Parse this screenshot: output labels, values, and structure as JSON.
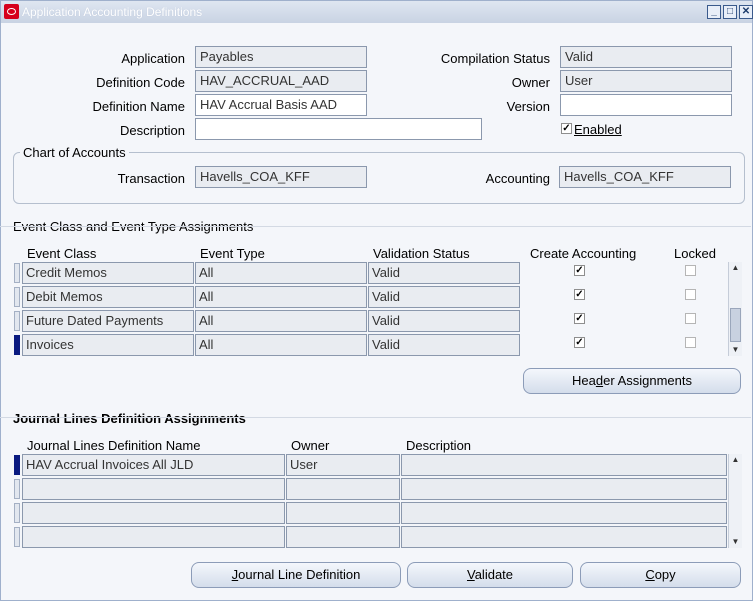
{
  "window": {
    "title": "Application Accounting Definitions"
  },
  "header_form": {
    "application_label": "Application",
    "application_value": "Payables",
    "definition_code_label": "Definition Code",
    "definition_code_value": "HAV_ACCRUAL_AAD",
    "definition_name_label": "Definition Name",
    "definition_name_value": "HAV Accrual Basis AAD",
    "description_label": "Description",
    "description_value": "",
    "compilation_status_label": "Compilation Status",
    "compilation_status_value": "Valid",
    "owner_label": "Owner",
    "owner_value": "User",
    "version_label": "Version",
    "version_value": "",
    "enabled_label": "Enabled",
    "enabled_checked": true
  },
  "chart_of_accounts": {
    "title": "Chart of Accounts",
    "transaction_label": "Transaction",
    "transaction_value": "Havells_COA_KFF",
    "accounting_label": "Accounting",
    "accounting_value": "Havells_COA_KFF"
  },
  "event_assignments": {
    "title": "Event Class and Event Type Assignments",
    "columns": {
      "event_class": "Event Class",
      "event_type": "Event Type",
      "validation_status": "Validation Status",
      "create_accounting": "Create Accounting",
      "locked": "Locked"
    },
    "rows": [
      {
        "event_class": "Credit Memos",
        "event_type": "All",
        "validation_status": "Valid",
        "create_accounting": true,
        "locked": false
      },
      {
        "event_class": "Debit Memos",
        "event_type": "All",
        "validation_status": "Valid",
        "create_accounting": true,
        "locked": false
      },
      {
        "event_class": "Future Dated Payments",
        "event_type": "All",
        "validation_status": "Valid",
        "create_accounting": true,
        "locked": false
      },
      {
        "event_class": "Invoices",
        "event_type": "All",
        "validation_status": "Valid",
        "create_accounting": true,
        "locked": false
      }
    ],
    "header_assignments_button": {
      "pre": "Hea",
      "key": "d",
      "post": "er Assignments"
    }
  },
  "jld_assignments": {
    "title": "Journal Lines Definition Assignments",
    "columns": {
      "name": "Journal Lines Definition Name",
      "owner": "Owner",
      "description": "Description"
    },
    "rows": [
      {
        "name": "HAV Accrual Invoices All JLD",
        "owner": "User",
        "description": ""
      },
      {
        "name": "",
        "owner": "",
        "description": ""
      },
      {
        "name": "",
        "owner": "",
        "description": ""
      },
      {
        "name": "",
        "owner": "",
        "description": ""
      }
    ]
  },
  "buttons": {
    "journal_line_definition": {
      "key": "J",
      "post": "ournal Line Definition"
    },
    "validate": {
      "key": "V",
      "post": "alidate"
    },
    "copy": {
      "key": "C",
      "post": "opy"
    }
  },
  "colors": {
    "selected_row": "#0a1a80",
    "titlebar": "#c9d3e3"
  }
}
